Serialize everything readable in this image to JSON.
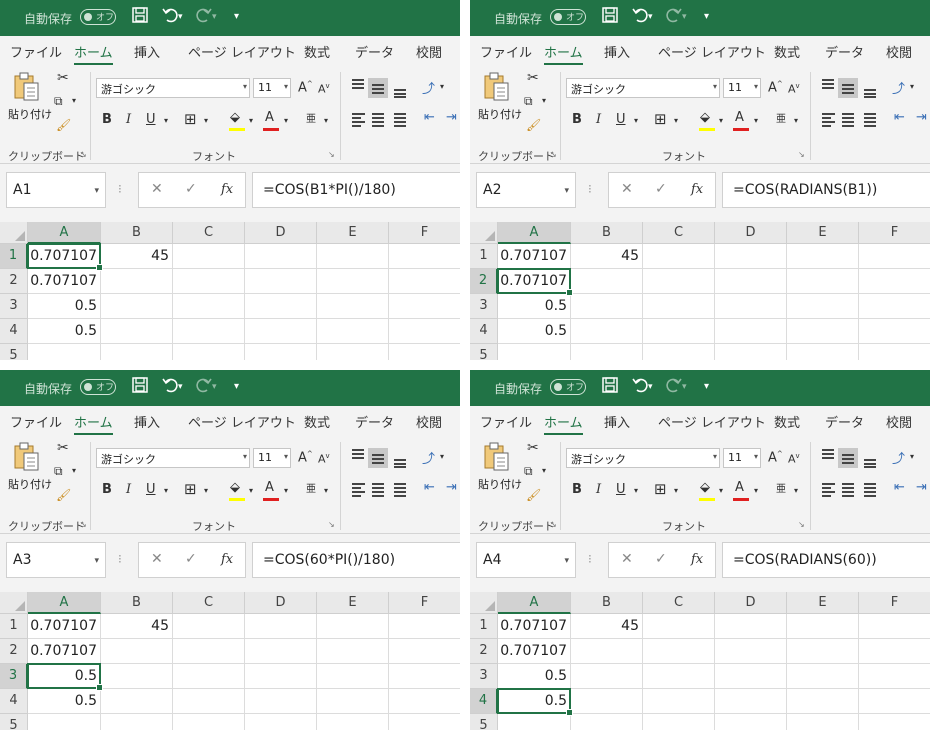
{
  "app": {
    "autosave_label": "自動保存",
    "autosave_state": "オフ",
    "tabs": [
      "ファイル",
      "ホーム",
      "挿入",
      "ページ レイアウト",
      "数式",
      "データ",
      "校閲"
    ],
    "active_tab": "ホーム",
    "ribbon": {
      "paste_label": "貼り付け",
      "clipboard_group": "クリップボード",
      "font_group": "フォント",
      "font_name": "游ゴシック",
      "font_size": "11",
      "bold": "B",
      "italic": "I",
      "underline": "U",
      "font_color_letter": "A",
      "grow_letter": "A",
      "shrink_letter": "A"
    },
    "formula_icons": {
      "cancel": "✕",
      "enter": "✓",
      "fx": "fx"
    },
    "colors": {
      "accent": "#217346",
      "highlight": "#ffff00",
      "font_red": "#e02020"
    }
  },
  "grid": {
    "columns": [
      "A",
      "B",
      "C",
      "D",
      "E",
      "F"
    ],
    "rows": [
      "1",
      "2",
      "3",
      "4",
      "5"
    ],
    "cells": {
      "A1": "0.707107",
      "B1": "45",
      "A2": "0.707107",
      "A3": "0.5",
      "A4": "0.5"
    }
  },
  "panels": [
    {
      "namebox": "A1",
      "formula": "=COS(B1*PI()/180)"
    },
    {
      "namebox": "A2",
      "formula": "=COS(RADIANS(B1))"
    },
    {
      "namebox": "A3",
      "formula": "=COS(60*PI()/180)"
    },
    {
      "namebox": "A4",
      "formula": "=COS(RADIANS(60))"
    }
  ]
}
